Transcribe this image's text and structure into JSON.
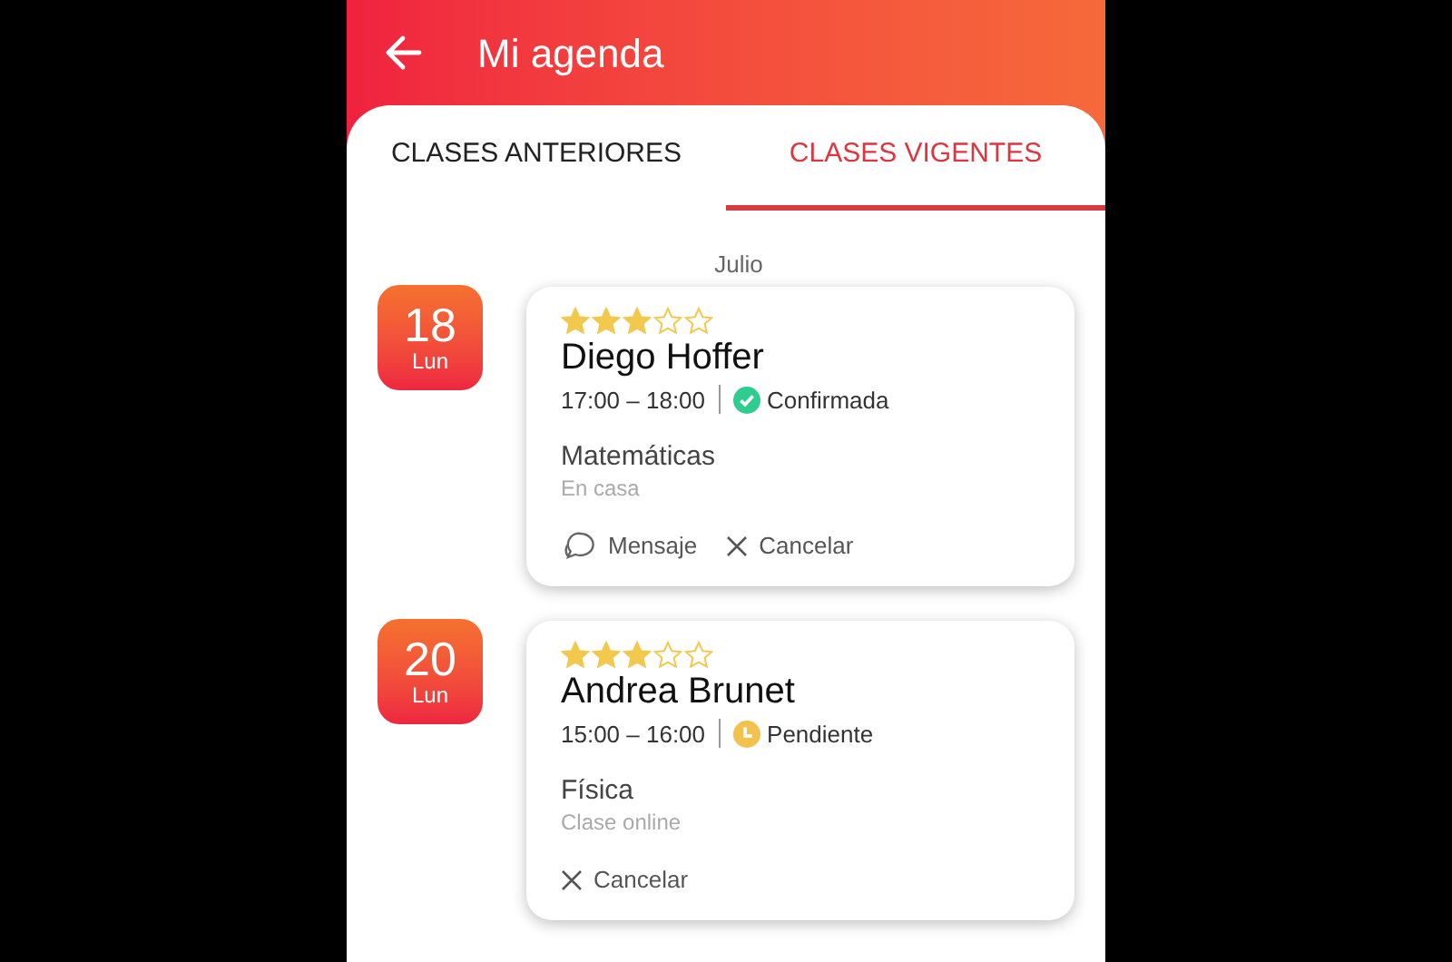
{
  "header": {
    "title": "Mi agenda"
  },
  "tabs": [
    {
      "label": "CLASES ANTERIORES",
      "selected": false
    },
    {
      "label": "CLASES VIGENTES",
      "selected": true
    }
  ],
  "month": "Julio",
  "classes": [
    {
      "day": "18",
      "weekday": "Lun",
      "stars": 3,
      "teacher": "Diego Hoffer",
      "time": "17:00 – 18:00",
      "status": {
        "kind": "confirmed",
        "label": "Confirmada"
      },
      "subject": "Matemáticas",
      "place": "En casa",
      "actions": [
        {
          "kind": "message",
          "label": "Mensaje"
        },
        {
          "kind": "cancel",
          "label": "Cancelar"
        }
      ]
    },
    {
      "day": "20",
      "weekday": "Lun",
      "stars": 3,
      "teacher": "Andrea Brunet",
      "time": "15:00 – 16:00",
      "status": {
        "kind": "pending",
        "label": "Pendiente"
      },
      "subject": "Física",
      "place": "Clase online",
      "actions": [
        {
          "kind": "cancel",
          "label": "Cancelar"
        }
      ]
    }
  ]
}
